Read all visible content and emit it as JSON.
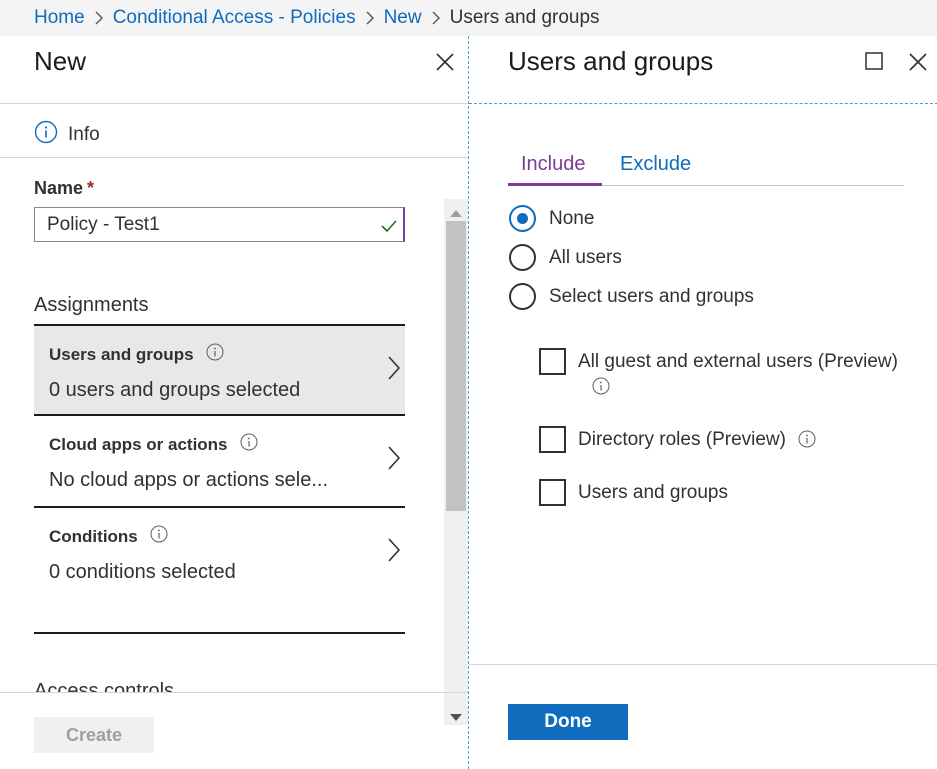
{
  "breadcrumb": {
    "items": [
      "Home",
      "Conditional Access - Policies",
      "New"
    ],
    "current": "Users and groups"
  },
  "left_blade": {
    "title": "New",
    "info_label": "Info",
    "name_label": "Name",
    "required_mark": "*",
    "name_value": "Policy - Test1",
    "assignments_label": "Assignments",
    "assignments": [
      {
        "title": "Users and groups",
        "value": "0 users and groups selected",
        "selected": true
      },
      {
        "title": "Cloud apps or actions",
        "value": "No cloud apps or actions sele...",
        "selected": false
      },
      {
        "title": "Conditions",
        "value": "0 conditions selected",
        "selected": false
      }
    ],
    "access_controls_label": "Access controls",
    "create_label": "Create",
    "create_enabled": false
  },
  "right_blade": {
    "title": "Users and groups",
    "tabs": {
      "include": "Include",
      "exclude": "Exclude",
      "active": "include"
    },
    "radios": [
      {
        "label": "None",
        "checked": true
      },
      {
        "label": "All users",
        "checked": false
      },
      {
        "label": "Select users and groups",
        "checked": false
      }
    ],
    "checkboxes": [
      {
        "label": "All guest and external users (Preview)",
        "checked": false,
        "has_info": true
      },
      {
        "label": "Directory roles (Preview)",
        "checked": false,
        "has_info": true
      },
      {
        "label": "Users and groups",
        "checked": false,
        "has_info": false
      }
    ],
    "done_label": "Done"
  },
  "colors": {
    "link": "#0f6cbd",
    "accent_purple": "#7d3c98",
    "primary_button": "#0f6cbd",
    "valid_check": "#107c10",
    "required": "#a4262c"
  },
  "icons": {
    "close": "close-icon",
    "maximize": "maximize-icon",
    "info": "info-icon",
    "chevron": "chevron-right-icon",
    "check": "checkmark-icon"
  }
}
